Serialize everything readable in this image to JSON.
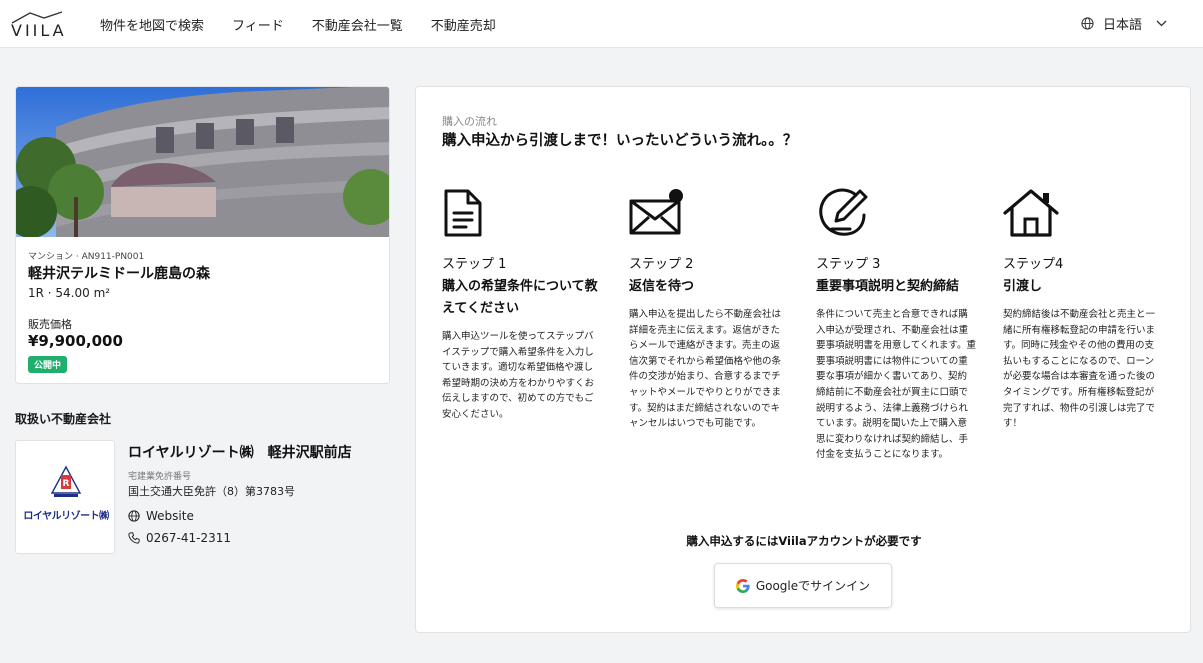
{
  "header": {
    "logo_text": "VIILA",
    "nav": [
      "物件を地図で検索",
      "フィード",
      "不動産会社一覧",
      "不動産売却"
    ],
    "language": "日本語"
  },
  "property": {
    "meta": "マンション · AN911-PN001",
    "name": "軽井沢テルミドール鹿島の森",
    "size": "1R · 54.00 m²",
    "price_label": "販売価格",
    "price": "¥9,900,000",
    "status": "公開中"
  },
  "agent": {
    "heading": "取扱い不動産会社",
    "logo_text": "ロイヤルリゾート㈱",
    "name": "ロイヤルリゾート㈱　軽井沢駅前店",
    "license_label": "宅建業免許番号",
    "license_value": "国土交通大臣免許（8）第3783号",
    "website_label": "Website",
    "phone": "0267-41-2311"
  },
  "flow": {
    "label": "購入の流れ",
    "title": "購入申込から引渡しまで！いったいどういう流れ。。？",
    "steps": [
      {
        "icon": "document-icon",
        "number": "ステップ 1",
        "title": "購入の希望条件について教えてください",
        "desc": "購入申込ツールを使ってステップバイステップで購入希望条件を入力していきます。適切な希望価格や渡し希望時期の決め方をわかりやすくお伝えしますので、初めての方でもご安心ください。"
      },
      {
        "icon": "mail-notification-icon",
        "number": "ステップ 2",
        "title": "返信を待つ",
        "desc": "購入申込を提出したら不動産会社は詳細を売主に伝えます。返信がきたらメールで連絡がきます。売主の返信次第でそれから希望価格や他の条件の交渉が始まり、合意するまでチャットやメールでやりとりができます。契約はまだ締結されないのでキャンセルはいつでも可能です。"
      },
      {
        "icon": "pen-signature-icon",
        "number": "ステップ 3",
        "title": "重要事項説明と契約締結",
        "desc": "条件について売主と合意できれば購入申込が受理され、不動産会社は重要事項説明書を用意してくれます。重要事項説明書には物件についての重要な事項が細かく書いてあり、契約締結前に不動産会社が買主に口頭で説明するよう、法律上義務づけられています。説明を聞いた上で購入意思に変わりなければ契約締結し、手付金を支払うことになります。"
      },
      {
        "icon": "house-icon",
        "number": "ステップ4",
        "title": "引渡し",
        "desc": "契約締結後は不動産会社と売主と一緒に所有権移転登記の申請を行います。同時に残金やその他の費用の支払いもすることになるので、ローンが必要な場合は本審査を通った後のタイミングです。所有権移転登記が完了すれば、物件の引渡しは完了です！"
      }
    ],
    "signin_note": "購入申込するにはViilaアカウントが必要です",
    "google_button": "Googleでサインイン"
  },
  "colors": {
    "status_badge": "#1fae6c",
    "agent_brand": "#1d2f86",
    "background": "#f2f3f5"
  }
}
